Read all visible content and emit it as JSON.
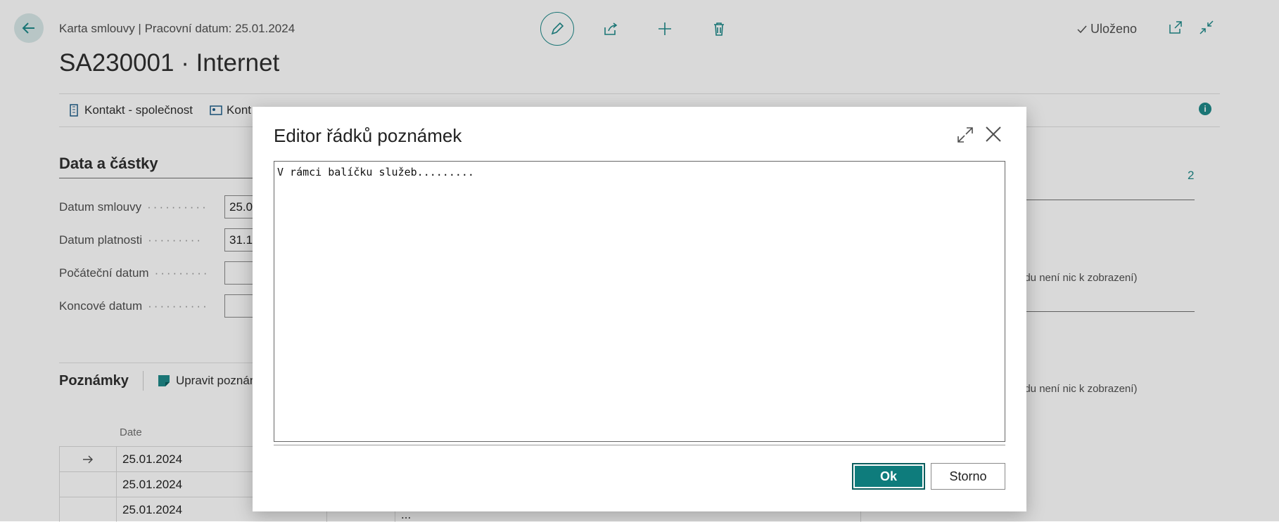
{
  "header": {
    "breadcrumb": "Karta smlouvy | Pracovní datum: 25.01.2024",
    "title": "SA230001 · Internet",
    "status": "Uloženo"
  },
  "actionbar": {
    "items": [
      "Kontakt - společnost",
      "Kont"
    ]
  },
  "data_section": {
    "title": "Data a částky",
    "fields": [
      {
        "label": "Datum smlouvy",
        "value": "25.0"
      },
      {
        "label": "Datum platnosti",
        "value": "31.1"
      },
      {
        "label": "Počáteční datum",
        "value": ""
      },
      {
        "label": "Koncové datum",
        "value": ""
      }
    ]
  },
  "notes": {
    "title": "Poznámky",
    "edit_label": "Upravit poznán",
    "date_header": "Date",
    "rows": [
      "25.01.2024",
      "25.01.2024",
      "25.01.2024"
    ],
    "last_row_text": "..."
  },
  "right_panel": {
    "count": "2",
    "empty_text_1": "edu není nic k zobrazení)",
    "empty_text_2": "edu není nic k zobrazení)"
  },
  "dialog": {
    "title": "Editor řádků poznámek",
    "text": "V rámci balíčku služeb.........",
    "ok_label": "Ok",
    "cancel_label": "Storno"
  },
  "colors": {
    "accent": "#0e7c7c",
    "overlay": "rgba(0,0,0,0.15)"
  }
}
